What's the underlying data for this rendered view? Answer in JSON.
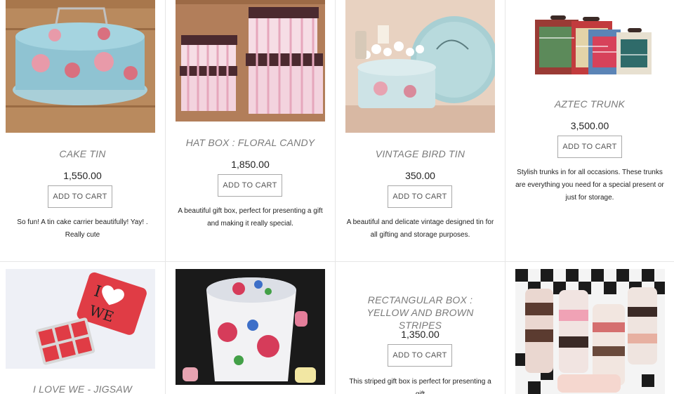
{
  "products": [
    {
      "title": "CAKE TIN",
      "price": "1,550.00",
      "button": "ADD TO CART",
      "desc": "So fun! A tin cake carrier beautifully! Yay! . Really cute",
      "image": "floral-cake-tin-photo"
    },
    {
      "title": "HAT BOX : FLORAL CANDY",
      "price": "1,850.00",
      "button": "ADD TO CART",
      "desc": "A beautiful gift box, perfect for presenting a gift and making it really special.",
      "image": "striped-hat-boxes-photo"
    },
    {
      "title": "VINTAGE BIRD TIN",
      "price": "350.00",
      "button": "ADD TO CART",
      "desc": "A beautiful and delicate vintage designed tin for all gifting and storage purposes.",
      "image": "vintage-bird-tin-photo"
    },
    {
      "title": "AZTEC TRUNK",
      "price": "3,500.00",
      "button": "ADD TO CART",
      "desc": "Stylish trunks in for all occasions. These trunks are everything you need for a special present or just for storage.",
      "image": "aztec-trunks-photo"
    },
    {
      "title": "I LOVE WE - JIGSAW",
      "image": "i-love-we-jigsaw-photo"
    },
    {
      "title": "",
      "image": "painted-tin-bucket-photo"
    },
    {
      "title": "RECTANGULAR BOX : YELLOW AND BROWN STRIPES",
      "price": "1,350.00",
      "button": "ADD TO CART",
      "desc": "This striped gift box is perfect for presenting a gift",
      "image": ""
    },
    {
      "title": "",
      "image": "cake-push-pops-photo"
    }
  ]
}
